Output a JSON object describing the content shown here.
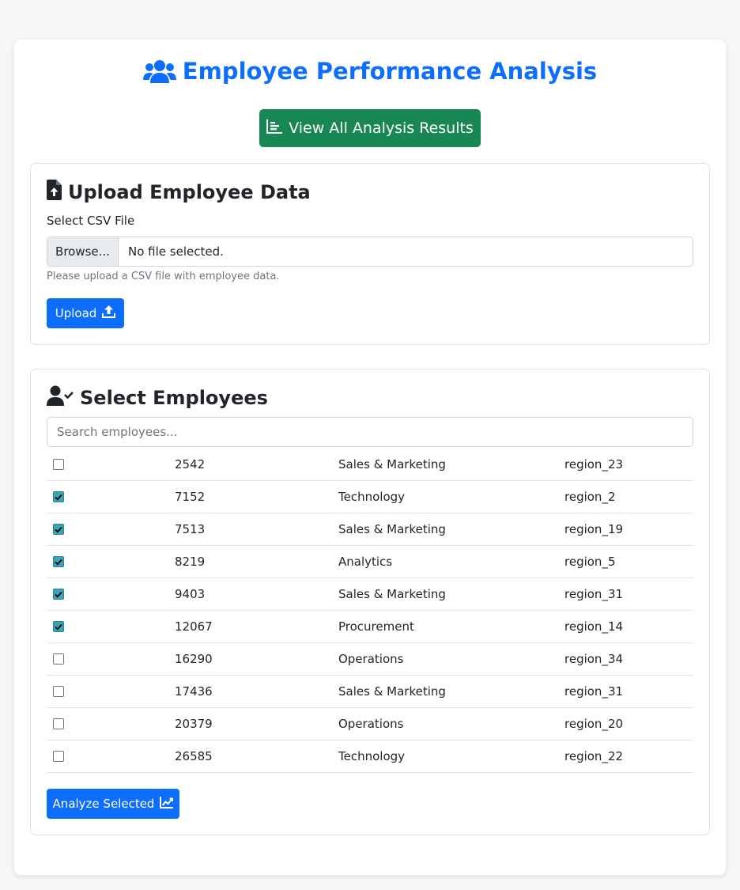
{
  "header": {
    "title": "Employee Performance Analysis",
    "title_icon": "users-icon",
    "view_results_label": "View All Analysis Results",
    "view_results_icon": "chart-bar-icon"
  },
  "upload": {
    "title": "Upload Employee Data",
    "title_icon": "file-upload-icon",
    "file_label": "Select CSV File",
    "browse_label": "Browse...",
    "file_status": "No file selected.",
    "help_text": "Please upload a CSV file with employee data.",
    "upload_label": "Upload",
    "upload_icon": "upload-icon"
  },
  "employees": {
    "title": "Select Employees",
    "title_icon": "user-check-icon",
    "search_placeholder": "Search employees...",
    "search_value": "",
    "rows": [
      {
        "checked": false,
        "id": "2542",
        "department": "Sales & Marketing",
        "region": "region_23"
      },
      {
        "checked": true,
        "id": "7152",
        "department": "Technology",
        "region": "region_2"
      },
      {
        "checked": true,
        "id": "7513",
        "department": "Sales & Marketing",
        "region": "region_19"
      },
      {
        "checked": true,
        "id": "8219",
        "department": "Analytics",
        "region": "region_5"
      },
      {
        "checked": true,
        "id": "9403",
        "department": "Sales & Marketing",
        "region": "region_31"
      },
      {
        "checked": true,
        "id": "12067",
        "department": "Procurement",
        "region": "region_14"
      },
      {
        "checked": false,
        "id": "16290",
        "department": "Operations",
        "region": "region_34"
      },
      {
        "checked": false,
        "id": "17436",
        "department": "Sales & Marketing",
        "region": "region_31"
      },
      {
        "checked": false,
        "id": "20379",
        "department": "Operations",
        "region": "region_20"
      },
      {
        "checked": false,
        "id": "26585",
        "department": "Technology",
        "region": "region_22"
      }
    ],
    "analyze_label": "Analyze Selected",
    "analyze_icon": "chart-line-icon"
  },
  "colors": {
    "primary": "#0d6efd",
    "success": "#198754",
    "checkbox_checked": "#3ba5b5"
  }
}
